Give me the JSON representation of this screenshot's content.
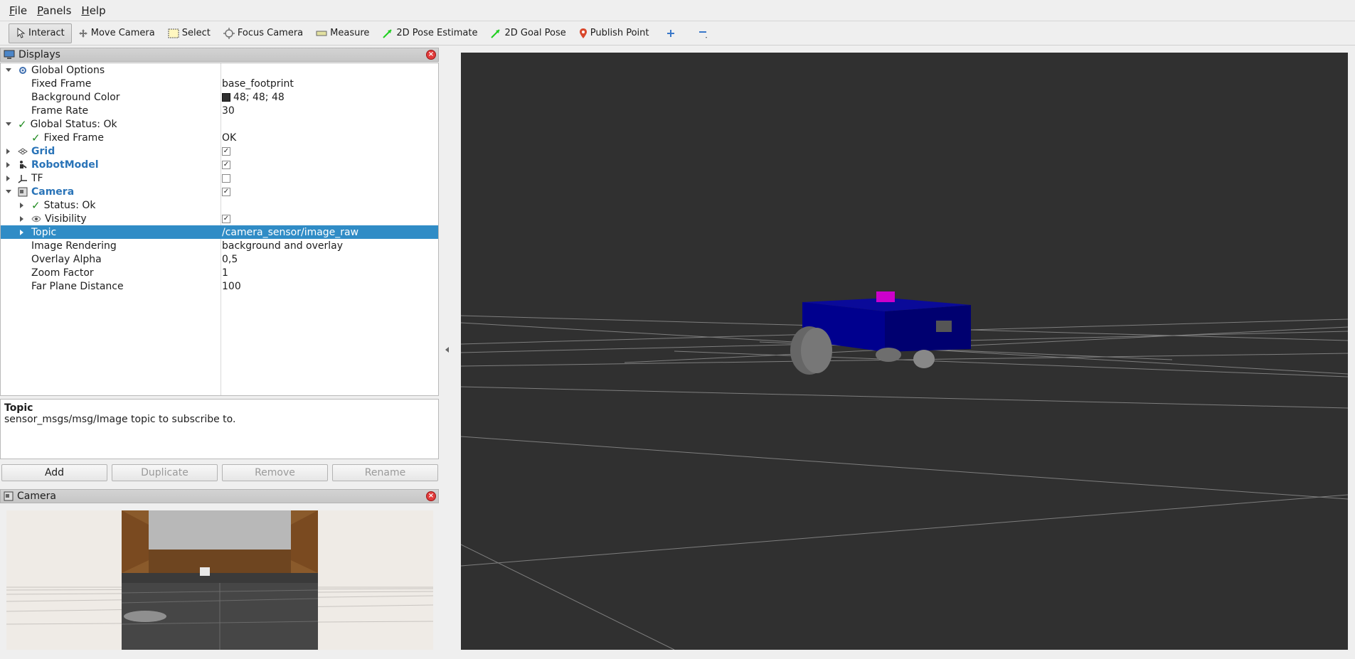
{
  "menu": [
    "File",
    "Panels",
    "Help"
  ],
  "menu_underline": [
    "F",
    "P",
    "H"
  ],
  "toolbar": {
    "interact": "Interact",
    "move_camera": "Move Camera",
    "select": "Select",
    "focus_camera": "Focus Camera",
    "measure": "Measure",
    "pose_estimate": "2D Pose Estimate",
    "goal_pose": "2D Goal Pose",
    "publish_point": "Publish Point"
  },
  "displays_panel": {
    "title": "Displays",
    "rows": [
      {
        "name": "Global Options",
        "value": ""
      },
      {
        "name": "Fixed Frame",
        "value": "base_footprint"
      },
      {
        "name": "Background Color",
        "value": "48; 48; 48"
      },
      {
        "name": "Frame Rate",
        "value": "30"
      },
      {
        "name": "Global Status: Ok",
        "value": ""
      },
      {
        "name": "Fixed Frame",
        "value": "OK"
      },
      {
        "name": "Grid",
        "value": ""
      },
      {
        "name": "RobotModel",
        "value": ""
      },
      {
        "name": "TF",
        "value": ""
      },
      {
        "name": "Camera",
        "value": ""
      },
      {
        "name": "Status: Ok",
        "value": ""
      },
      {
        "name": "Visibility",
        "value": ""
      },
      {
        "name": "Topic",
        "value": "/camera_sensor/image_raw"
      },
      {
        "name": "Image Rendering",
        "value": "background and overlay"
      },
      {
        "name": "Overlay Alpha",
        "value": "0,5"
      },
      {
        "name": "Zoom Factor",
        "value": "1"
      },
      {
        "name": "Far Plane Distance",
        "value": "100"
      }
    ],
    "checkboxes": {
      "grid": true,
      "robotmodel": true,
      "tf": false,
      "camera": true,
      "visibility": true
    }
  },
  "description": {
    "title": "Topic",
    "text": "sensor_msgs/msg/Image topic to subscribe to."
  },
  "buttons": {
    "add": "Add",
    "duplicate": "Duplicate",
    "remove": "Remove",
    "rename": "Rename"
  },
  "camera_panel": {
    "title": "Camera"
  },
  "colors": {
    "background": "#303030",
    "selection": "#308cc6",
    "robot_body": "#000080",
    "camera_marker": "#cc00cc"
  }
}
